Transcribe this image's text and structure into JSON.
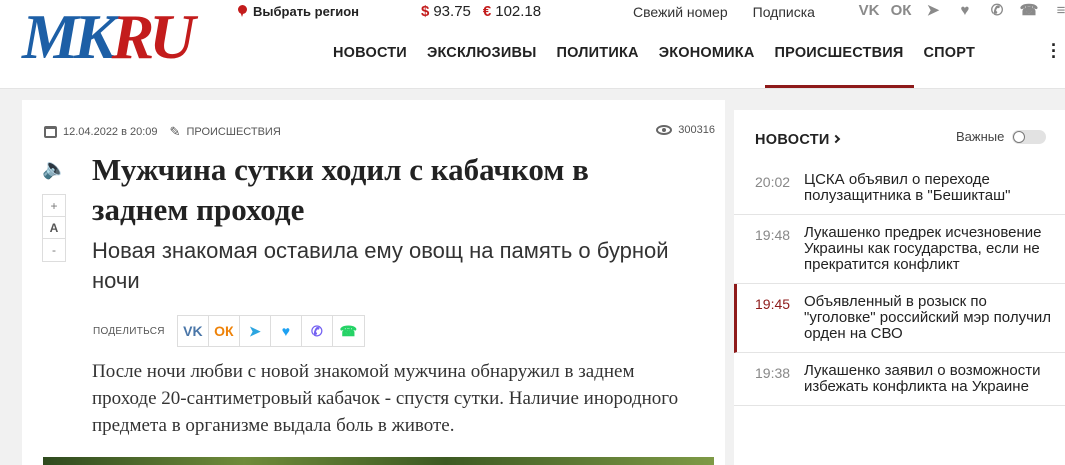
{
  "header": {
    "logo_mk": "MK",
    "logo_ru": "RU",
    "region_label": "Выбрать регион",
    "usd_symbol": "$",
    "usd_rate": "93.75",
    "eur_symbol": "€",
    "eur_rate": "102.18",
    "links": [
      "Свежий номер",
      "Подписка"
    ],
    "socials": [
      {
        "name": "vk-icon",
        "glyph": "VK"
      },
      {
        "name": "odnoklassniki-icon",
        "glyph": "ОК"
      },
      {
        "name": "telegram-icon",
        "glyph": "➤"
      },
      {
        "name": "twitter-icon",
        "glyph": "♥"
      },
      {
        "name": "viber-icon",
        "glyph": "✆"
      },
      {
        "name": "whatsapp-icon",
        "glyph": "☎"
      },
      {
        "name": "menu-icon",
        "glyph": "≡"
      }
    ],
    "nav": [
      "НОВОСТИ",
      "ЭКСКЛЮЗИВЫ",
      "ПОЛИТИКА",
      "ЭКОНОМИКА",
      "ПРОИСШЕСТВИЯ",
      "СПОРТ"
    ],
    "nav_active_index": 4
  },
  "article": {
    "date": "12.04.2022 в 20:09",
    "rubric": "ПРОИСШЕСТВИЯ",
    "views": "300316",
    "font_plus": "+",
    "font_a": "A",
    "font_minus": "-",
    "title": "Мужчина сутки ходил с кабачком в заднем проходе",
    "subtitle": "Новая знакомая оставила ему овощ на память о бурной ночи",
    "share_label": "ПОДЕЛИТЬСЯ",
    "share_buttons": [
      {
        "name": "share-vk-button",
        "glyph": "VK",
        "color": "#4a76a8"
      },
      {
        "name": "share-ok-button",
        "glyph": "ОК",
        "color": "#ee8208"
      },
      {
        "name": "share-telegram-button",
        "glyph": "➤",
        "color": "#2ca5e0"
      },
      {
        "name": "share-twitter-button",
        "glyph": "♥",
        "color": "#1da1f2"
      },
      {
        "name": "share-viber-button",
        "glyph": "✆",
        "color": "#7360f2"
      },
      {
        "name": "share-whatsapp-button",
        "glyph": "☎",
        "color": "#25d366"
      }
    ],
    "lead": "После ночи любви с новой знакомой мужчина обнаружил в заднем проходе 20-сантиметровый кабачок - спустя сутки. Наличие инородного предмета в организме выдала боль в животе."
  },
  "sidebar": {
    "heading": "НОВОСТИ",
    "important_label": "Важные",
    "items": [
      {
        "time": "20:02",
        "text": "ЦСКА объявил о переходе полузащитника в \"Бешикташ\"",
        "highlight": false
      },
      {
        "time": "19:48",
        "text": "Лукашенко предрек исчезновение Украины как государства, если не прекратится конфликт",
        "highlight": false
      },
      {
        "time": "19:45",
        "text": "Объявленный в розыск по \"уголовке\" российский мэр получил орден на СВО",
        "highlight": true
      },
      {
        "time": "19:38",
        "text": "Лукашенко заявил о возможности избежать конфликта на Украине",
        "highlight": false
      }
    ]
  },
  "colors": {
    "brand_blue": "#1d5fa6",
    "brand_red": "#c31c1c",
    "accent_dark_red": "#8e1a1a"
  }
}
